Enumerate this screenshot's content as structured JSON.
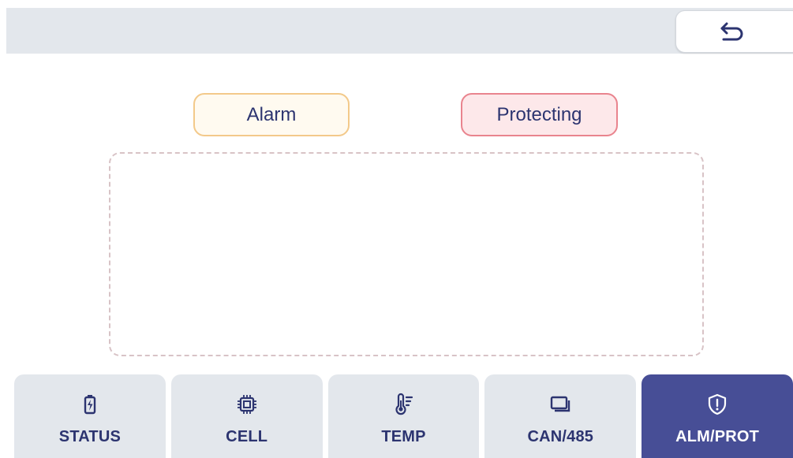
{
  "header": {
    "back_icon": "undo-arrow-icon"
  },
  "filters": {
    "alarm_label": "Alarm",
    "protecting_label": "Protecting"
  },
  "colors": {
    "accent": "#474e96",
    "text": "#2c3470",
    "alarm_border": "#f3c98a",
    "alarm_bg": "#fffaf0",
    "protecting_border": "#e9848e",
    "protecting_bg": "#fde8ea",
    "tab_bg": "#e3e7ec"
  },
  "nav": {
    "active": "ALM/PROT",
    "tabs": [
      {
        "label": "STATUS",
        "icon": "battery-charging-icon"
      },
      {
        "label": "CELL",
        "icon": "chip-icon"
      },
      {
        "label": "TEMP",
        "icon": "thermometer-icon"
      },
      {
        "label": "CAN/485",
        "icon": "windows-icon"
      },
      {
        "label": "ALM/PROT",
        "icon": "shield-alert-icon"
      }
    ]
  }
}
